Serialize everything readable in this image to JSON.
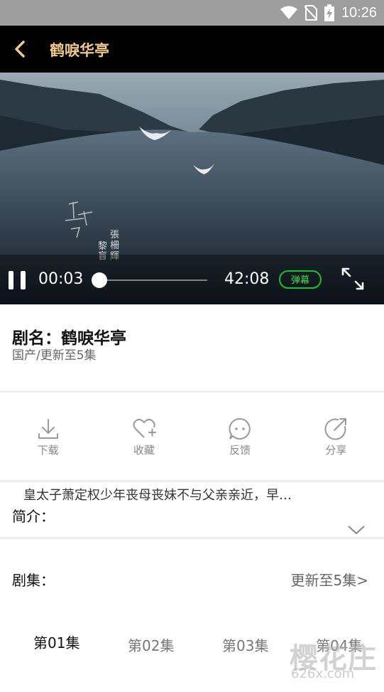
{
  "status": {
    "time": "10:26"
  },
  "appbar": {
    "title": "鹤唳华亭"
  },
  "player": {
    "current_time": "00:03",
    "total_time": "42:08",
    "danmu_label": "弹幕",
    "progress": 0.0012,
    "overlay_text": [
      "上",
      "品",
      "人",
      "黎",
      "張",
      "柵",
      "輝"
    ]
  },
  "show": {
    "name": "剧名：鹤唳华亭",
    "subtitle": "国产/更新至5集"
  },
  "actions": [
    {
      "label": "下载",
      "icon": "download-icon"
    },
    {
      "label": "收藏",
      "icon": "favorite-icon"
    },
    {
      "label": "反馈",
      "icon": "feedback-icon"
    },
    {
      "label": "分享",
      "icon": "share-icon"
    }
  ],
  "description": {
    "text": "皇太子萧定权少年丧母丧妹不与父亲亲近，早…",
    "label": "简介："
  },
  "episodes": {
    "label": "剧集：",
    "more": "更新至5集>",
    "items": [
      "第01集",
      "第02集",
      "第03集",
      "第04集"
    ],
    "active_index": 0
  },
  "watermark": {
    "main": "樱花庄",
    "sub": "626x.com"
  }
}
